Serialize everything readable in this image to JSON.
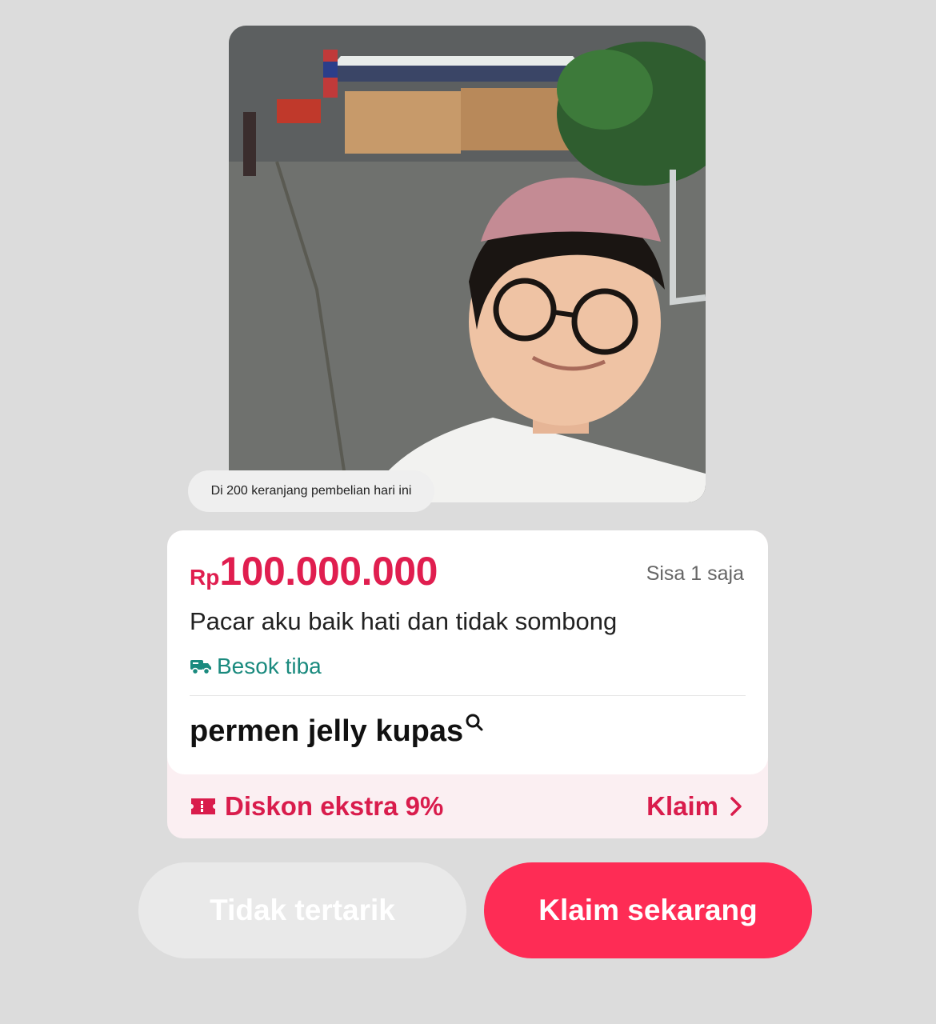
{
  "product": {
    "image_alt": "selfie",
    "cart_text": "Di 200 keranjang pembelian hari ini",
    "price_currency": "Rp",
    "price_amount": "100.000.000",
    "stock_text": "Sisa 1 saja",
    "title": "Pacar aku baik hati dan tidak sombong",
    "delivery_text": "Besok tiba",
    "search_term": "permen jelly kupas"
  },
  "promo": {
    "discount_text": "Diskon ekstra 9%",
    "claim_label": "Klaim"
  },
  "actions": {
    "not_interested_label": "Tidak tertarik",
    "claim_now_label": "Klaim sekarang"
  },
  "colors": {
    "price": "#e01e4f",
    "delivery": "#1a8a7e",
    "primary_button": "#fe2c55",
    "promo_bg": "#fbeff2"
  },
  "icons": {
    "delivery": "truck-icon",
    "search": "search-icon",
    "discount": "ticket-icon",
    "claim": "chevron-right-icon"
  }
}
